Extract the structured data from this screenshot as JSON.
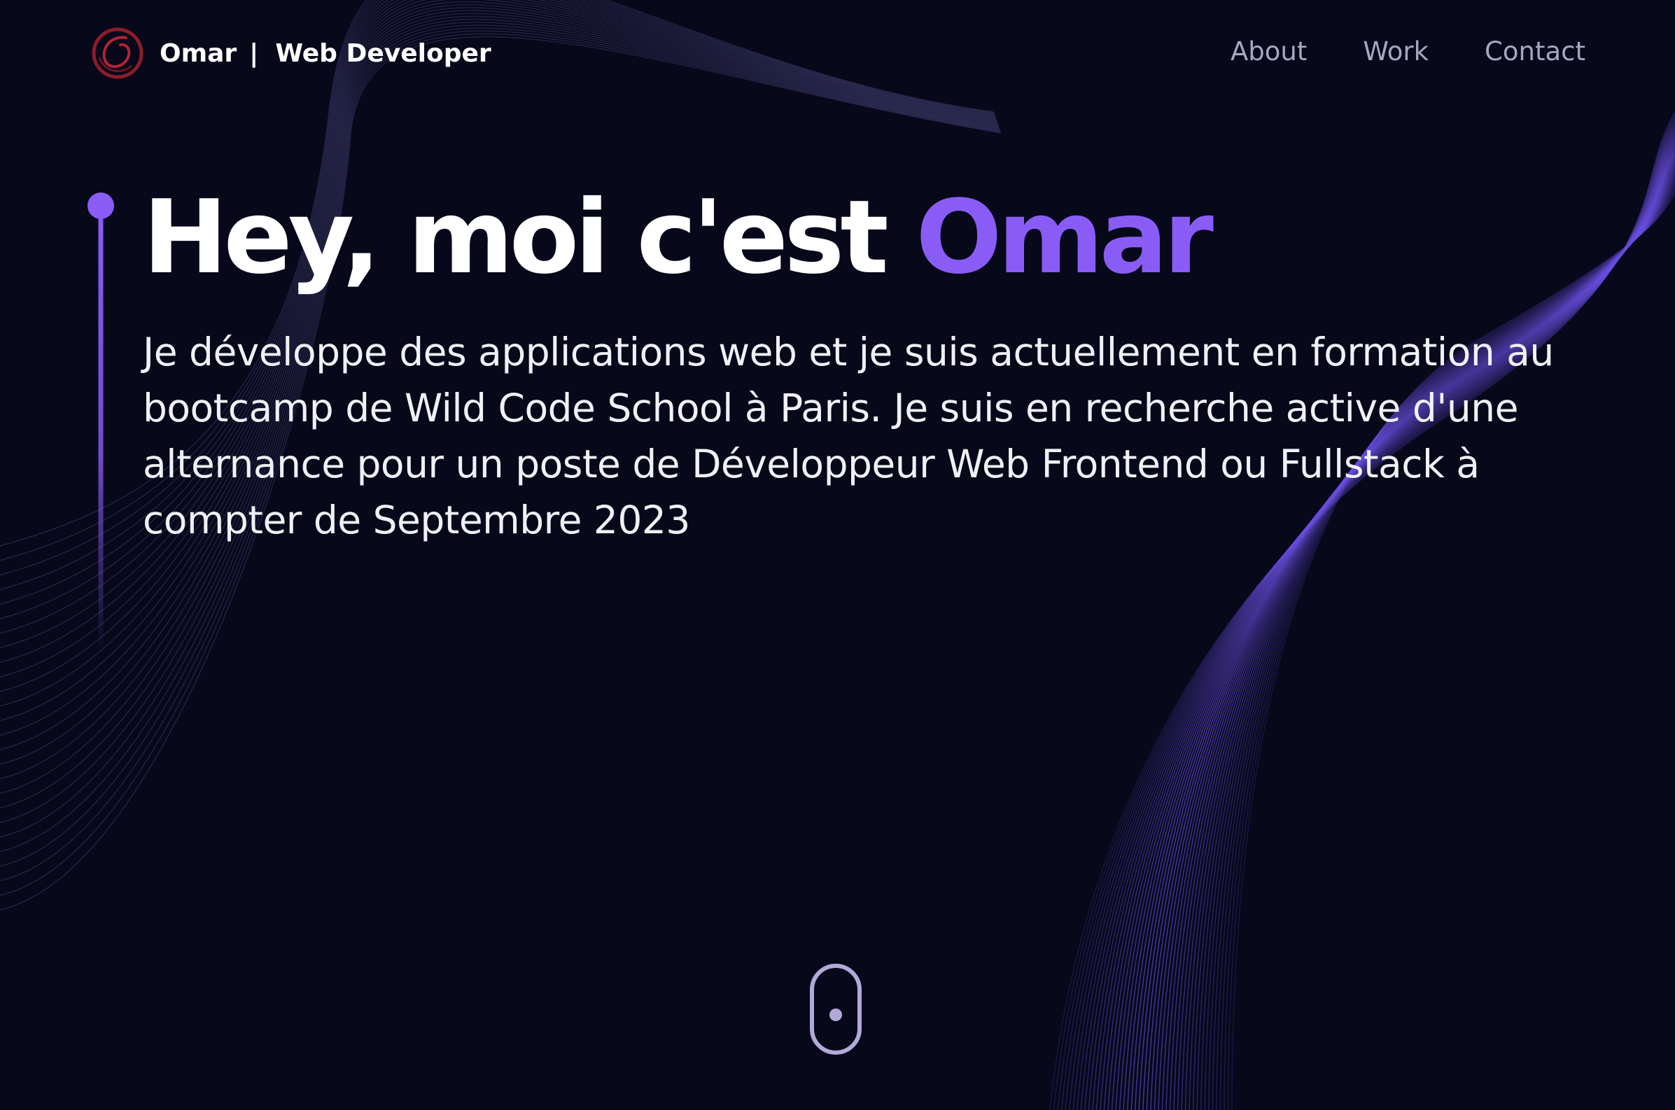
{
  "header": {
    "brand_name": "Omar",
    "brand_separator": "|",
    "brand_role": "Web Developer",
    "nav": [
      {
        "label": "About"
      },
      {
        "label": "Work"
      },
      {
        "label": "Contact"
      }
    ]
  },
  "hero": {
    "title_prefix": "Hey, moi c'est",
    "title_highlight": "Omar",
    "description": "Je développe des applications web et je suis actuellement en formation au bootcamp de Wild Code School à Paris. Je suis en recherche active d'une alternance pour un poste de Développeur Web Frontend ou Fullstack à compter de Septembre 2023"
  },
  "colors": {
    "background": "#07081a",
    "accent": "#8a5cf6",
    "nav_text": "#a9a6bf",
    "logo": "#8c1c2a"
  },
  "icons": {
    "logo": "swirl-logo-icon",
    "scroll": "mouse-scroll-icon"
  }
}
